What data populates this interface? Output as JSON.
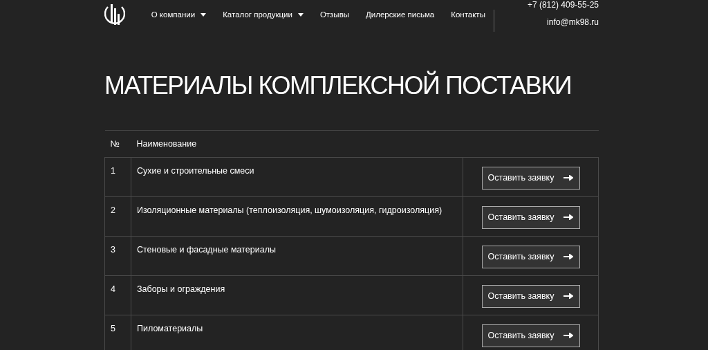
{
  "nav": [
    {
      "label": "О компании",
      "dropdown": true
    },
    {
      "label": "Каталог продукции",
      "dropdown": true
    },
    {
      "label": "Отзывы",
      "dropdown": false
    },
    {
      "label": "Дилерские письма",
      "dropdown": false
    },
    {
      "label": "Контакты",
      "dropdown": false
    }
  ],
  "contacts": {
    "phone": "+7 (812) 409-55-25",
    "email": "info@mk98.ru"
  },
  "title": "МАТЕРИАЛЫ КОМПЛЕКСНОЙ ПОСТАВКИ",
  "table": {
    "columns": [
      "№",
      "Наименование"
    ],
    "rows": [
      {
        "number": "1",
        "name": "Сухие и строительные смеси",
        "action": "Оставить заявку"
      },
      {
        "number": "2",
        "name": "Изоляционные материалы (теплоизоляция, шумоизоляция, гидроизоляция)",
        "action": "Оставить заявку"
      },
      {
        "number": "3",
        "name": "Стеновые и фасадные материалы",
        "action": "Оставить заявку"
      },
      {
        "number": "4",
        "name": "Заборы и ограждения",
        "action": "Оставить заявку"
      },
      {
        "number": "5",
        "name": "Пиломатериалы",
        "action": "Оставить заявку"
      }
    ]
  }
}
